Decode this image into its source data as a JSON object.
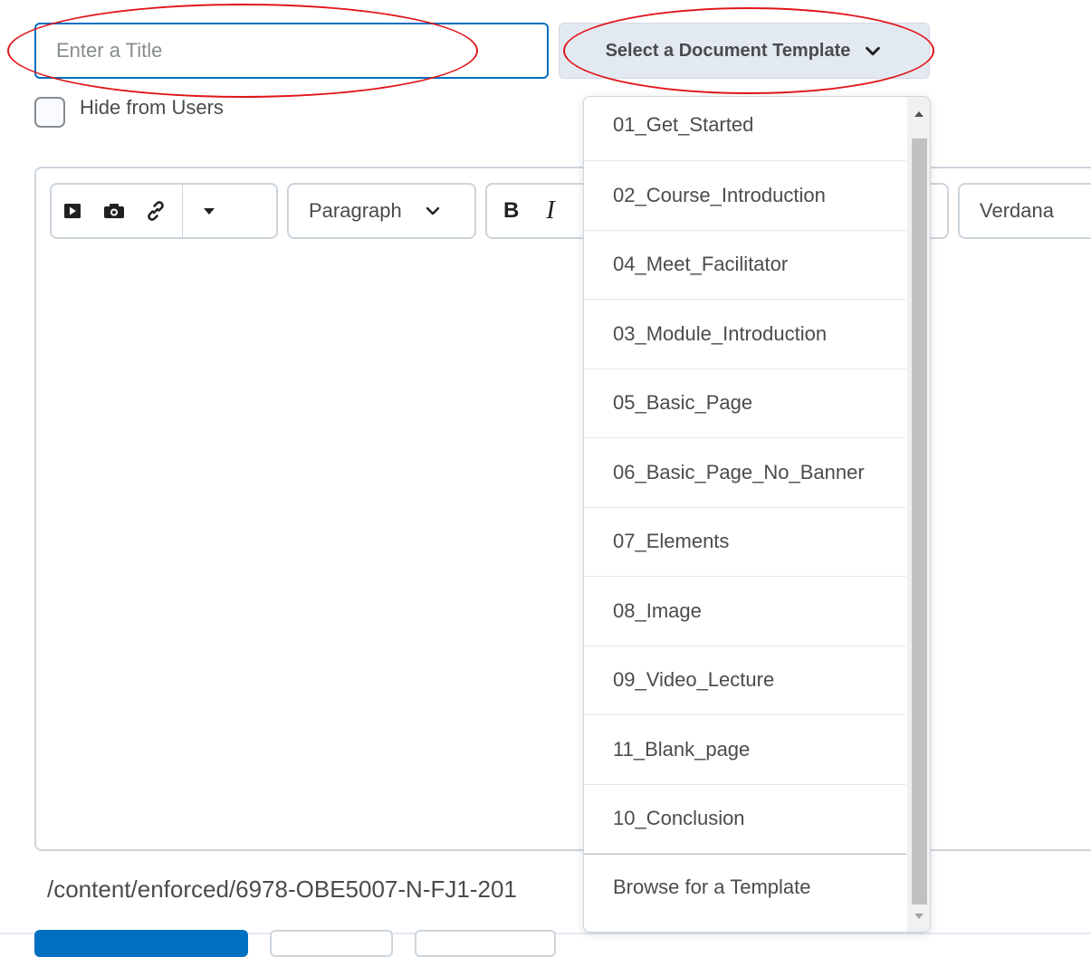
{
  "title_input": {
    "placeholder": "Enter a Title",
    "value": ""
  },
  "template_button": {
    "label": "Select a Document Template"
  },
  "hide_checkbox": {
    "label": "Hide from Users",
    "checked": false
  },
  "editor": {
    "toolbar": {
      "icons": [
        "video-icon",
        "camera-icon",
        "link-icon",
        "more-dropdown-icon"
      ],
      "block_format": "Paragraph",
      "bold_label": "B",
      "italic_label": "I",
      "font": "Verdana"
    }
  },
  "path_text": "/content/enforced/6978-OBE5007-N-FJ1-201",
  "dropdown": {
    "items": [
      "01_Get_Started",
      "02_Course_Introduction",
      "04_Meet_Facilitator",
      "03_Module_Introduction",
      "05_Basic_Page",
      "06_Basic_Page_No_Banner",
      "07_Elements",
      "08_Image",
      "09_Video_Lecture",
      "11_Blank_page",
      "10_Conclusion"
    ],
    "browse_label": "Browse for a Template"
  },
  "colors": {
    "accent": "#006fbf",
    "annotation": "#e0161b",
    "template_button_bg": "#e3e9f1",
    "border": "#cdd5dc"
  }
}
